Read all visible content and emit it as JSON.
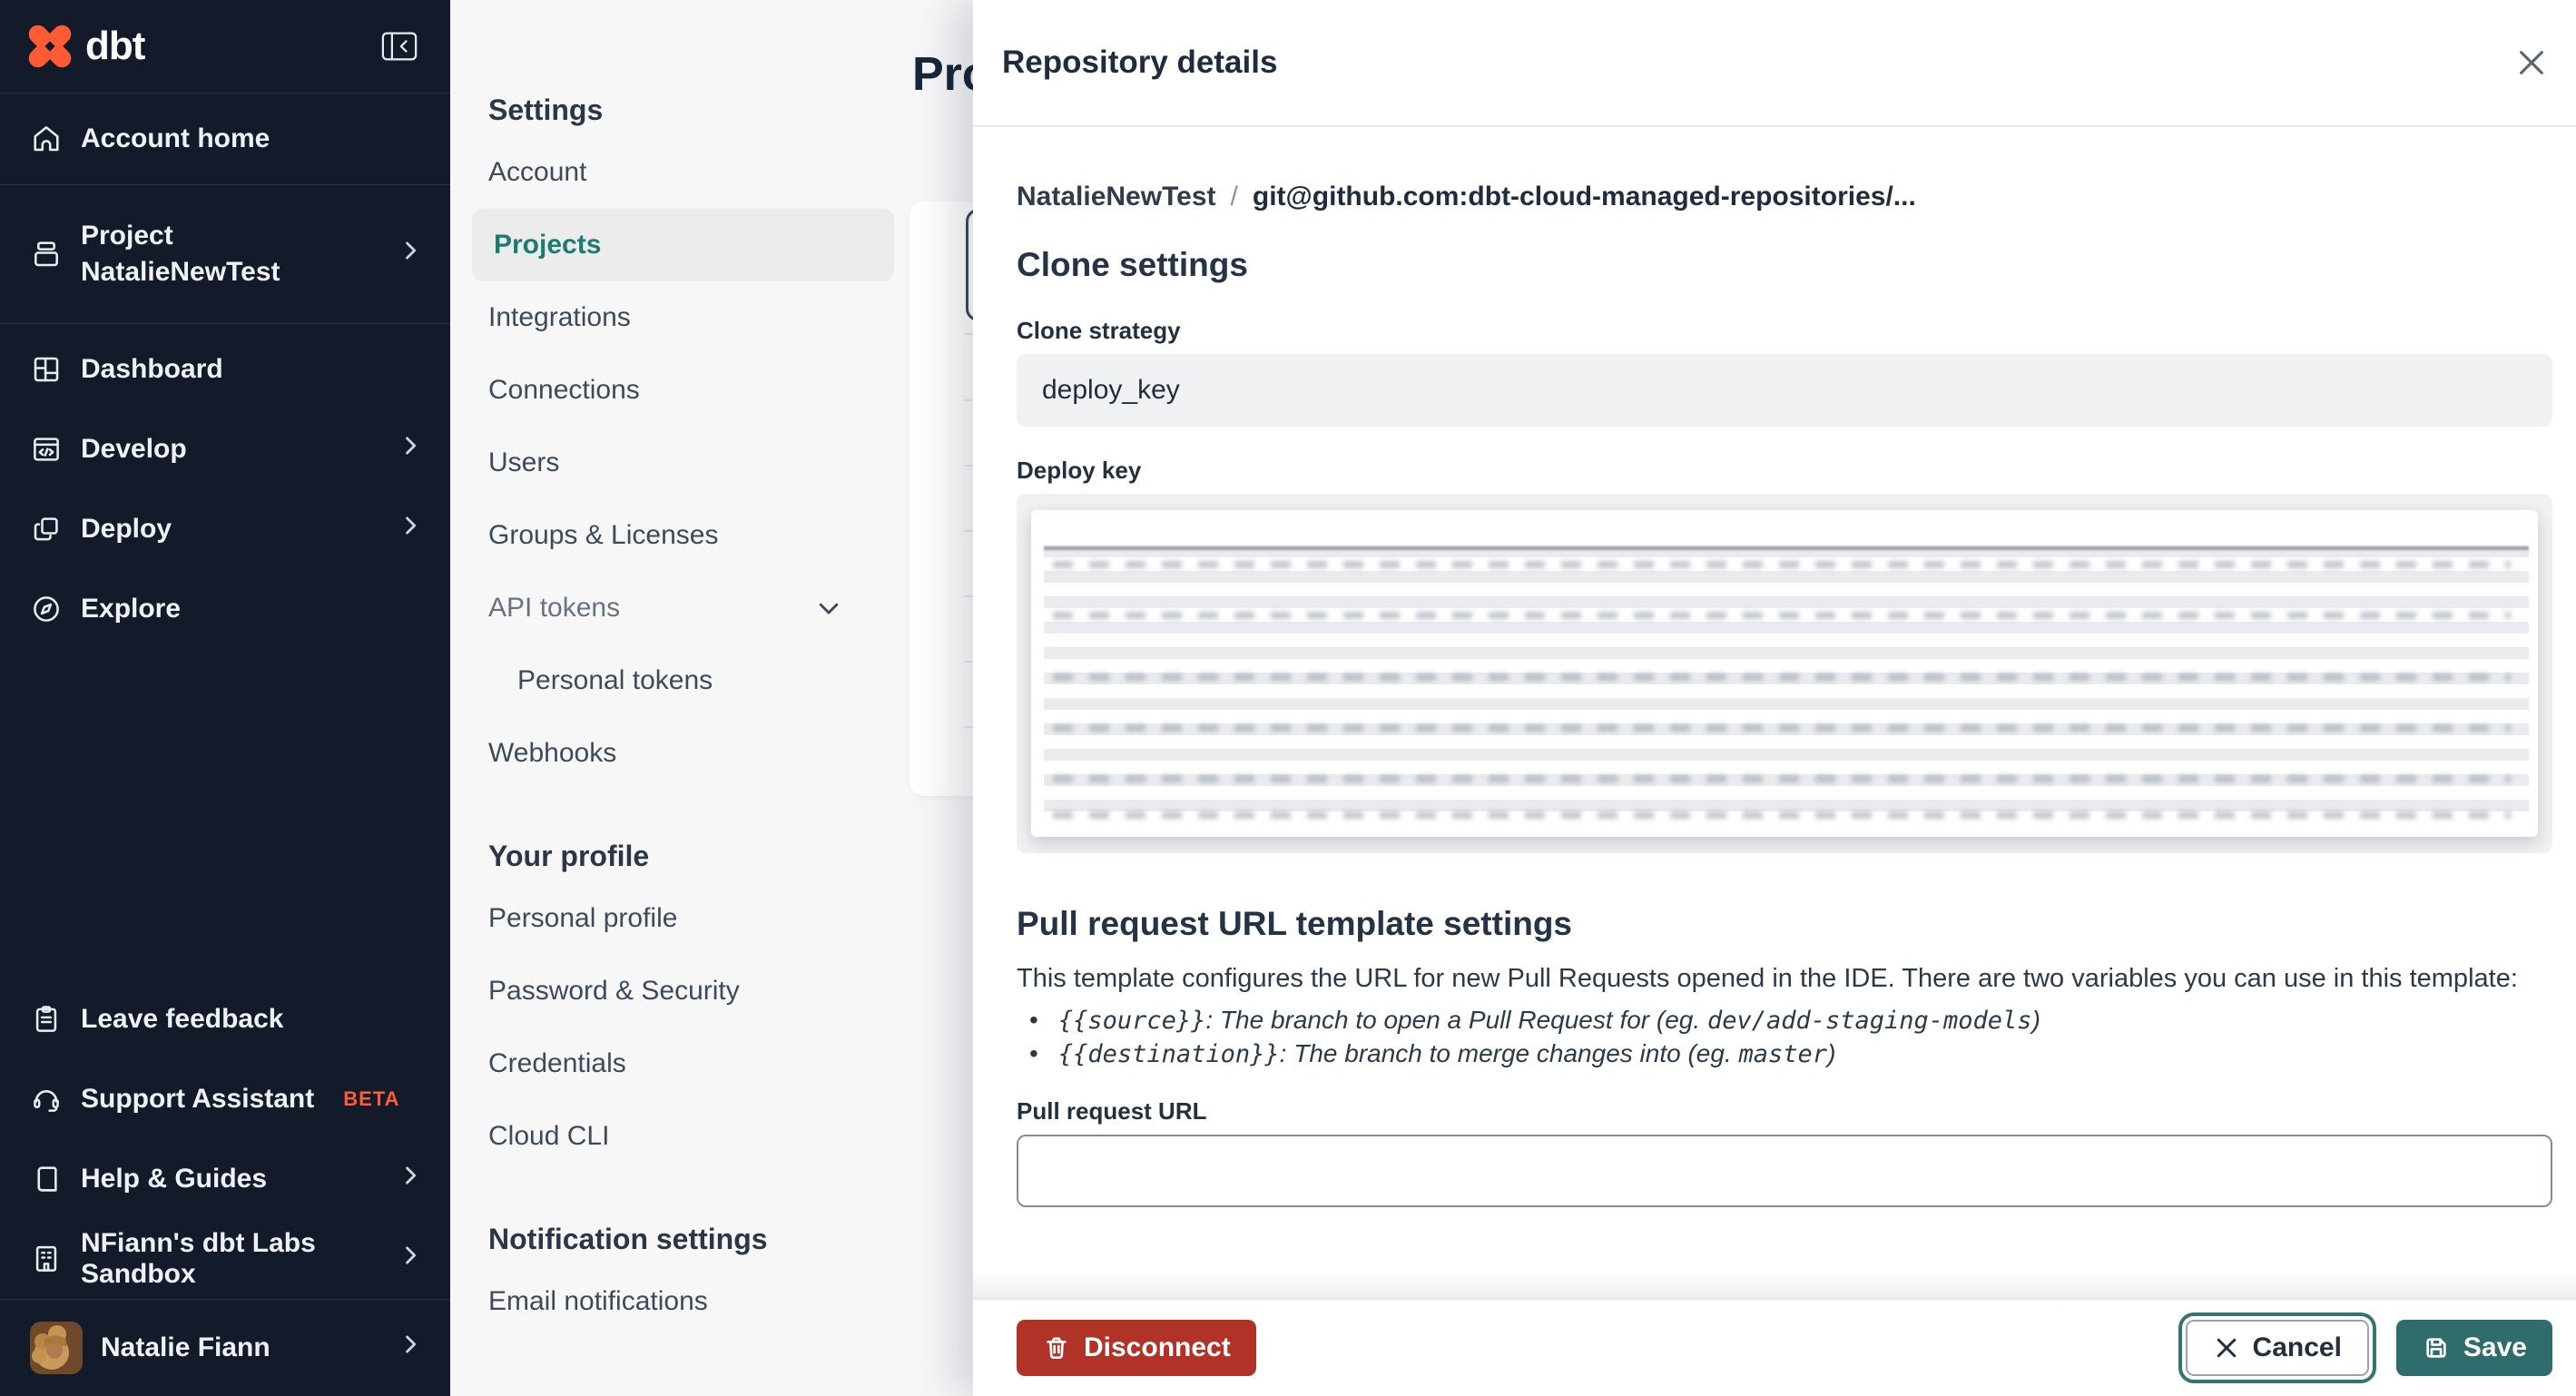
{
  "app": {
    "brand": "dbt"
  },
  "left_sidebar": {
    "items": [
      {
        "label": "Account home"
      },
      {
        "label_line1": "Project",
        "label_line2": "NatalieNewTest"
      },
      {
        "label": "Dashboard"
      },
      {
        "label": "Develop"
      },
      {
        "label": "Deploy"
      },
      {
        "label": "Explore"
      }
    ],
    "bottom_items": [
      {
        "label": "Leave feedback"
      },
      {
        "label": "Support Assistant",
        "badge": "BETA"
      },
      {
        "label": "Help & Guides"
      },
      {
        "label": "NFiann's dbt Labs Sandbox"
      }
    ],
    "user": {
      "name": "Natalie Fiann"
    }
  },
  "settings_nav": {
    "section1_heading": "Settings",
    "items": [
      "Account",
      "Projects",
      "Integrations",
      "Connections",
      "Users",
      "Groups & Licenses",
      "API tokens",
      "Personal tokens",
      "Webhooks"
    ],
    "section2_heading": "Your profile",
    "profile_items": [
      "Personal profile",
      "Password & Security",
      "Credentials",
      "Cloud CLI"
    ],
    "section3_heading": "Notification settings",
    "notification_items": [
      "Email notifications"
    ],
    "active_item": "Projects"
  },
  "main": {
    "page_title": "Projects"
  },
  "drawer": {
    "title": "Repository details",
    "breadcrumb": {
      "project": "NatalieNewTest",
      "separator": "/",
      "repository": "git@github.com:dbt-cloud-managed-repositories/..."
    },
    "clone_settings": {
      "heading": "Clone settings",
      "clone_strategy_label": "Clone strategy",
      "clone_strategy_value": "deploy_key",
      "deploy_key_label": "Deploy key"
    },
    "pr_template": {
      "heading": "Pull request URL template settings",
      "description": "This template configures the URL for new Pull Requests opened in the IDE. There are two variables you can use in this template:",
      "bullets": [
        {
          "code": "{{source}}",
          "text": ": The branch to open a Pull Request for (eg. ",
          "example": "dev/add-staging-models",
          "close": ")"
        },
        {
          "code": "{{destination}}",
          "text": ": The branch to merge changes into (eg. ",
          "example": "master",
          "close": ")"
        }
      ],
      "url_label": "Pull request URL",
      "url_value": ""
    },
    "footer": {
      "disconnect_label": "Disconnect",
      "cancel_label": "Cancel",
      "save_label": "Save"
    }
  },
  "colors": {
    "accent_orange": "#ff5c35",
    "active_teal": "#1d7b74",
    "save_teal": "#2f6d6d",
    "danger_red": "#b13226",
    "sidebar_bg": "#131a29",
    "heading_dark": "#1f2c3d"
  }
}
